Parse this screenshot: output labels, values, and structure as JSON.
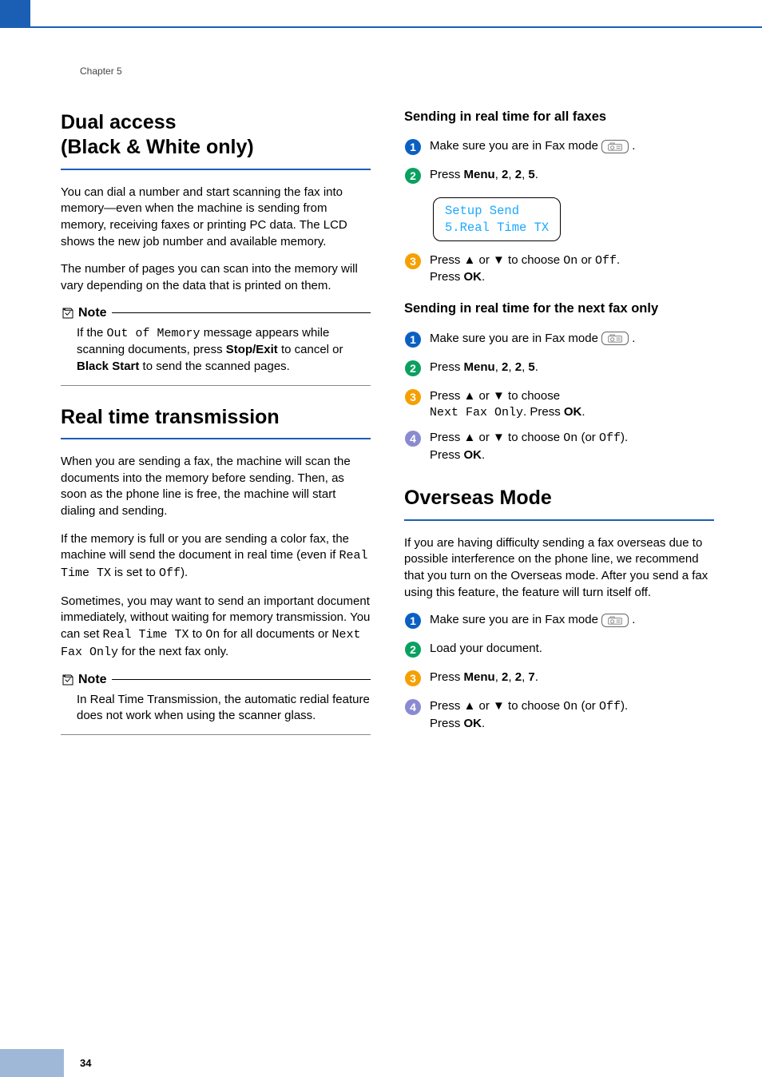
{
  "page": {
    "chapter": "Chapter 5",
    "number": "34"
  },
  "left": {
    "sec1_title": "Dual access\n(Black & White only)",
    "sec1_p1": "You can dial a number and start scanning the fax into memory—even when the machine is sending from memory, receiving faxes or printing PC data. The LCD shows the new job number and available memory.",
    "sec1_p2": "The number of pages you can scan into the memory will vary depending on the data that is printed on them.",
    "note1_label": "Note",
    "note1_pre": "If the ",
    "note1_mono": "Out of Memory",
    "note1_mid": " message appears while scanning documents, press ",
    "note1_b1": "Stop/Exit",
    "note1_mid2": " to cancel or ",
    "note1_b2": "Black Start",
    "note1_post": " to send the scanned pages.",
    "sec2_title": "Real time transmission",
    "sec2_p1": "When you are sending a fax, the machine will scan the documents into the memory before sending. Then, as soon as the phone line is free, the machine will start dialing and sending.",
    "sec2_p2_pre": "If the memory is full or you are sending a color fax, the machine will send the document in real time (even if ",
    "sec2_p2_mono1": "Real Time TX",
    "sec2_p2_mid": " is set to ",
    "sec2_p2_mono2": "Off",
    "sec2_p2_post": ").",
    "sec2_p3_pre": "Sometimes, you may want to send an important document immediately, without waiting for memory transmission. You can set ",
    "sec2_p3_m1": "Real Time TX",
    "sec2_p3_mid1": " to ",
    "sec2_p3_m2": "On",
    "sec2_p3_mid2": " for all documents or ",
    "sec2_p3_m3": "Next Fax Only",
    "sec2_p3_post": " for the next fax only.",
    "note2_label": "Note",
    "note2_body": "In Real Time Transmission, the automatic redial feature does not work when using the scanner glass."
  },
  "right": {
    "sub1": "Sending in real time for all faxes",
    "s1_step1": "Make sure you are in Fax mode ",
    "s1_step2_pre": "Press ",
    "s1_step2_b": "Menu",
    "s1_step2_post": ", 2, 2, 5.",
    "lcd1": "Setup Send\n5.Real Time TX",
    "s1_step3_a": "Press ▲ or ▼ to choose ",
    "s1_step3_m1": "On",
    "s1_step3_mid": " or ",
    "s1_step3_m2": "Off",
    "s1_step3_post": ".\nPress ",
    "s1_step3_ok": "OK",
    "sub2": "Sending in real time for the next fax only",
    "s2_step1": "Make sure you are in Fax mode ",
    "s2_step2_pre": "Press ",
    "s2_step2_b": "Menu",
    "s2_step2_post": ", 2, 2, 5.",
    "s2_step3_a": "Press ▲ or ▼ to choose ",
    "s2_step3_m": "Next Fax Only",
    "s2_step3_mid": ". Press ",
    "s2_step3_ok": "OK",
    "s2_step4_a": "Press ▲ or ▼ to choose ",
    "s2_step4_m1": "On",
    "s2_step4_mid": " (or ",
    "s2_step4_m2": "Off",
    "s2_step4_post": ").\nPress ",
    "s2_step4_ok": "OK",
    "sec3_title": "Overseas Mode",
    "sec3_p1": "If you are having difficulty sending a fax overseas due to possible interference on the phone line, we recommend that you turn on the Overseas mode. After you send a fax using this feature, the feature will turn itself off.",
    "s3_step1": "Make sure you are in Fax mode ",
    "s3_step2": "Load your document.",
    "s3_step3_pre": "Press ",
    "s3_step3_b": "Menu",
    "s3_step3_post": ", 2, 2, 7.",
    "s3_step4_a": "Press ▲ or ▼ to choose ",
    "s3_step4_m1": "On",
    "s3_step4_mid": " (or ",
    "s3_step4_m2": "Off",
    "s3_step4_post": ").\nPress ",
    "s3_step4_ok": "OK"
  },
  "icons": {
    "note": "note-icon",
    "fax": "fax-icon",
    "up": "▲",
    "down": "▼"
  }
}
